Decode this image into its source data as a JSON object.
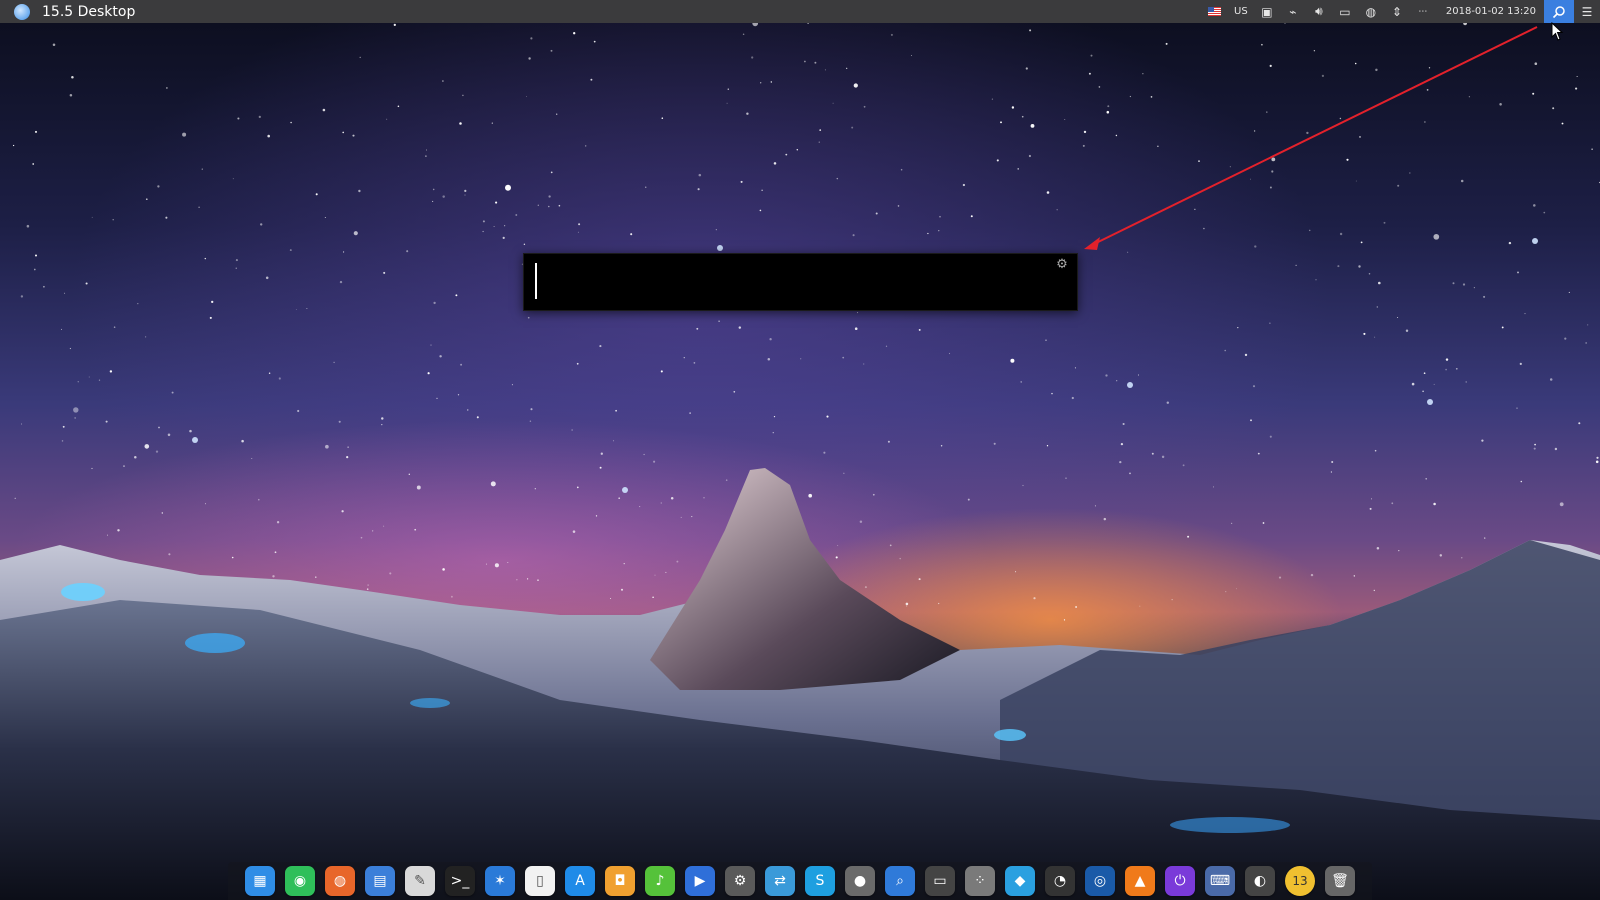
{
  "panel": {
    "title": "15.5 Desktop",
    "keyboard_layout": "US",
    "clock": "2018-01-02 13:20",
    "tray_icons": [
      "flag-icon",
      "keyboard-layout",
      "screenshot-icon",
      "network-icon",
      "volume-icon",
      "display-icon",
      "globe-icon",
      "up-down-icon",
      "net-speed-icon",
      "clock",
      "search-icon",
      "notifications-icon"
    ]
  },
  "search": {
    "value": "",
    "placeholder": ""
  },
  "annotation": {
    "color": "#e3212b"
  },
  "colors": {
    "panel_bg": "#3b3b3d",
    "search_accent": "#3a7fe0",
    "popup_bg": "#000000"
  },
  "dock": {
    "items": [
      {
        "name": "launcher-icon",
        "color": "#2f8de6",
        "glyph": "▦"
      },
      {
        "name": "deepin-store-icon",
        "color": "#2fbf5a",
        "glyph": "◉"
      },
      {
        "name": "firefox-icon",
        "color": "#e8662a",
        "glyph": "◍"
      },
      {
        "name": "file-manager-icon",
        "color": "#3b7fd9",
        "glyph": "▤"
      },
      {
        "name": "text-editor-icon",
        "color": "#d9d9d9",
        "glyph": "✎"
      },
      {
        "name": "terminal-icon",
        "color": "#222222",
        "glyph": ">_"
      },
      {
        "name": "deepin-icon",
        "color": "#2a7ad8",
        "glyph": "✶"
      },
      {
        "name": "document-icon",
        "color": "#f2f2f2",
        "glyph": "▯"
      },
      {
        "name": "app-store-icon",
        "color": "#1f8be8",
        "glyph": "A"
      },
      {
        "name": "shopping-bag-icon",
        "color": "#f0a030",
        "glyph": "◘"
      },
      {
        "name": "music-icon",
        "color": "#55c23a",
        "glyph": "♪"
      },
      {
        "name": "video-icon",
        "color": "#2f6fd9",
        "glyph": "▶"
      },
      {
        "name": "settings-icon",
        "color": "#5a5a5a",
        "glyph": "⚙"
      },
      {
        "name": "teamviewer-icon",
        "color": "#3a9ad9",
        "glyph": "⇄"
      },
      {
        "name": "skype-icon",
        "color": "#1e9fe0",
        "glyph": "S"
      },
      {
        "name": "disc-icon",
        "color": "#6a6a6a",
        "glyph": "●"
      },
      {
        "name": "search-app-icon",
        "color": "#2f7ad9",
        "glyph": "⌕"
      },
      {
        "name": "scanner-icon",
        "color": "#444444",
        "glyph": "▭"
      },
      {
        "name": "grid-icon",
        "color": "#7a7a7a",
        "glyph": "⁘"
      },
      {
        "name": "water-drop-icon",
        "color": "#2aa0e0",
        "glyph": "◆"
      },
      {
        "name": "speedometer-icon",
        "color": "#333333",
        "glyph": "◔"
      },
      {
        "name": "camera-icon",
        "color": "#1a5aa8",
        "glyph": "◎"
      },
      {
        "name": "vlc-icon",
        "color": "#f07a1a",
        "glyph": "▲"
      },
      {
        "name": "power-icon",
        "color": "#7a3ad9",
        "glyph": "⏻"
      },
      {
        "name": "keyboard-icon",
        "color": "#4a6aa8",
        "glyph": "⌨"
      },
      {
        "name": "stopwatch-icon",
        "color": "#444444",
        "glyph": "◐"
      },
      {
        "name": "calendar-icon",
        "color": "#f0c030",
        "glyph": "13"
      },
      {
        "name": "trash-icon",
        "color": "#666666",
        "glyph": "🗑"
      }
    ]
  }
}
